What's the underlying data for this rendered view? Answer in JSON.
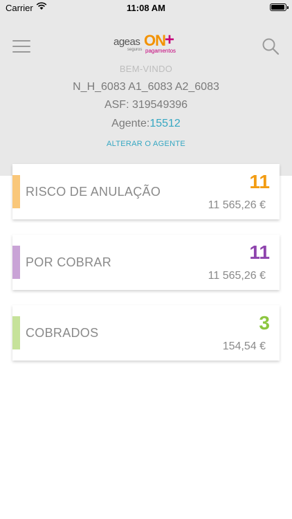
{
  "status_bar": {
    "carrier": "Carrier",
    "time": "11:08 AM"
  },
  "header": {
    "logo": {
      "brand": "ageas",
      "sub": "seguros",
      "product": "ON",
      "plus": "+",
      "product_sub": "pagamentos"
    },
    "welcome": "BEM-VINDO",
    "agent_names": "N_H_6083 A1_6083 A2_6083",
    "asf": "ASF: 319549396",
    "agent_label": "Agente:",
    "agent_code": "15512",
    "change_agent": "ALTERAR O AGENTE",
    "icons": {
      "menu": "hamburger-menu-icon",
      "search": "search-icon"
    }
  },
  "cards": [
    {
      "label": "RISCO DE ANULAÇÃO",
      "count": "11",
      "amount": "11 565,26 €",
      "color": "#f9c77a",
      "count_color": "#f39c12"
    },
    {
      "label": "POR COBRAR",
      "count": "11",
      "amount": "11 565,26 €",
      "color": "#c9a3d6",
      "count_color": "#8e44ad"
    },
    {
      "label": "COBRADOS",
      "count": "3",
      "amount": "154,54 €",
      "color": "#c6e29a",
      "count_color": "#8cc63f"
    }
  ]
}
